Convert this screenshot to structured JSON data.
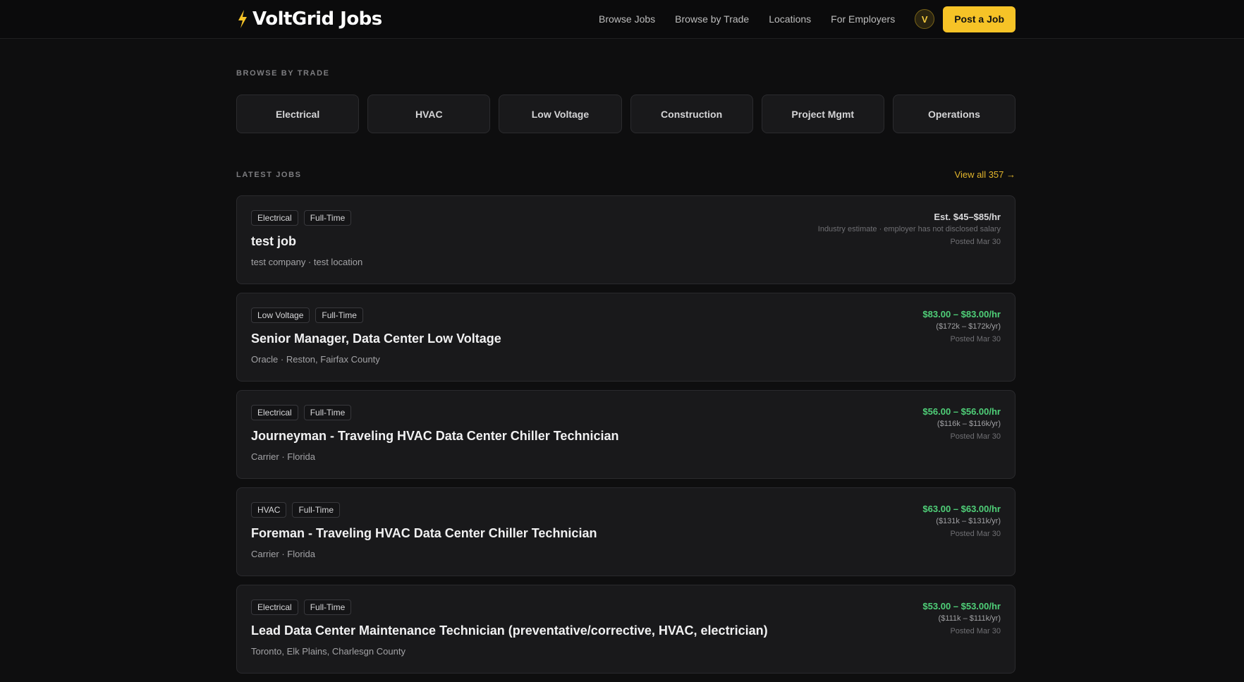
{
  "brand": {
    "name": "VoltGrid Jobs",
    "accent": "#f6c327"
  },
  "nav": {
    "links": [
      "Browse Jobs",
      "Browse by Trade",
      "Locations",
      "For Employers"
    ],
    "avatar_initial": "V",
    "post_label": "Post a Job"
  },
  "trades": {
    "heading": "BROWSE BY TRADE",
    "items": [
      "Electrical",
      "HVAC",
      "Low Voltage",
      "Construction",
      "Project Mgmt",
      "Operations"
    ]
  },
  "latest": {
    "heading": "LATEST JOBS",
    "view_all": "View all 357 →"
  },
  "jobs": [
    {
      "tags": [
        "Electrical",
        "Full-Time"
      ],
      "title": "test job",
      "meta": "test company · test location",
      "salary": "Est. $45–$85/hr",
      "annual": "Industry estimate · employer has not disclosed salary",
      "posted": "Posted Mar 30",
      "estimated": true
    },
    {
      "tags": [
        "Low Voltage",
        "Full-Time"
      ],
      "title": "Senior Manager, Data Center Low Voltage",
      "meta": "Oracle · Reston, Fairfax County",
      "salary": "$83.00 – $83.00/hr",
      "annual": "($172k – $172k/yr)",
      "posted": "Posted Mar 30",
      "estimated": false
    },
    {
      "tags": [
        "Electrical",
        "Full-Time"
      ],
      "title": "Journeyman - Traveling HVAC Data Center Chiller Technician",
      "meta": "Carrier · Florida",
      "salary": "$56.00 – $56.00/hr",
      "annual": "($116k – $116k/yr)",
      "posted": "Posted Mar 30",
      "estimated": false
    },
    {
      "tags": [
        "HVAC",
        "Full-Time"
      ],
      "title": "Foreman - Traveling HVAC Data Center Chiller Technician",
      "meta": "Carrier · Florida",
      "salary": "$63.00 – $63.00/hr",
      "annual": "($131k – $131k/yr)",
      "posted": "Posted Mar 30",
      "estimated": false
    },
    {
      "tags": [
        "Electrical",
        "Full-Time"
      ],
      "title": "Lead Data Center Maintenance Technician (preventative/corrective, HVAC, electrician)",
      "meta": "Toronto, Elk Plains, Charlesgn County",
      "salary": "$53.00 – $53.00/hr",
      "annual": "($111k – $111k/yr)",
      "posted": "Posted Mar 30",
      "estimated": false
    }
  ]
}
